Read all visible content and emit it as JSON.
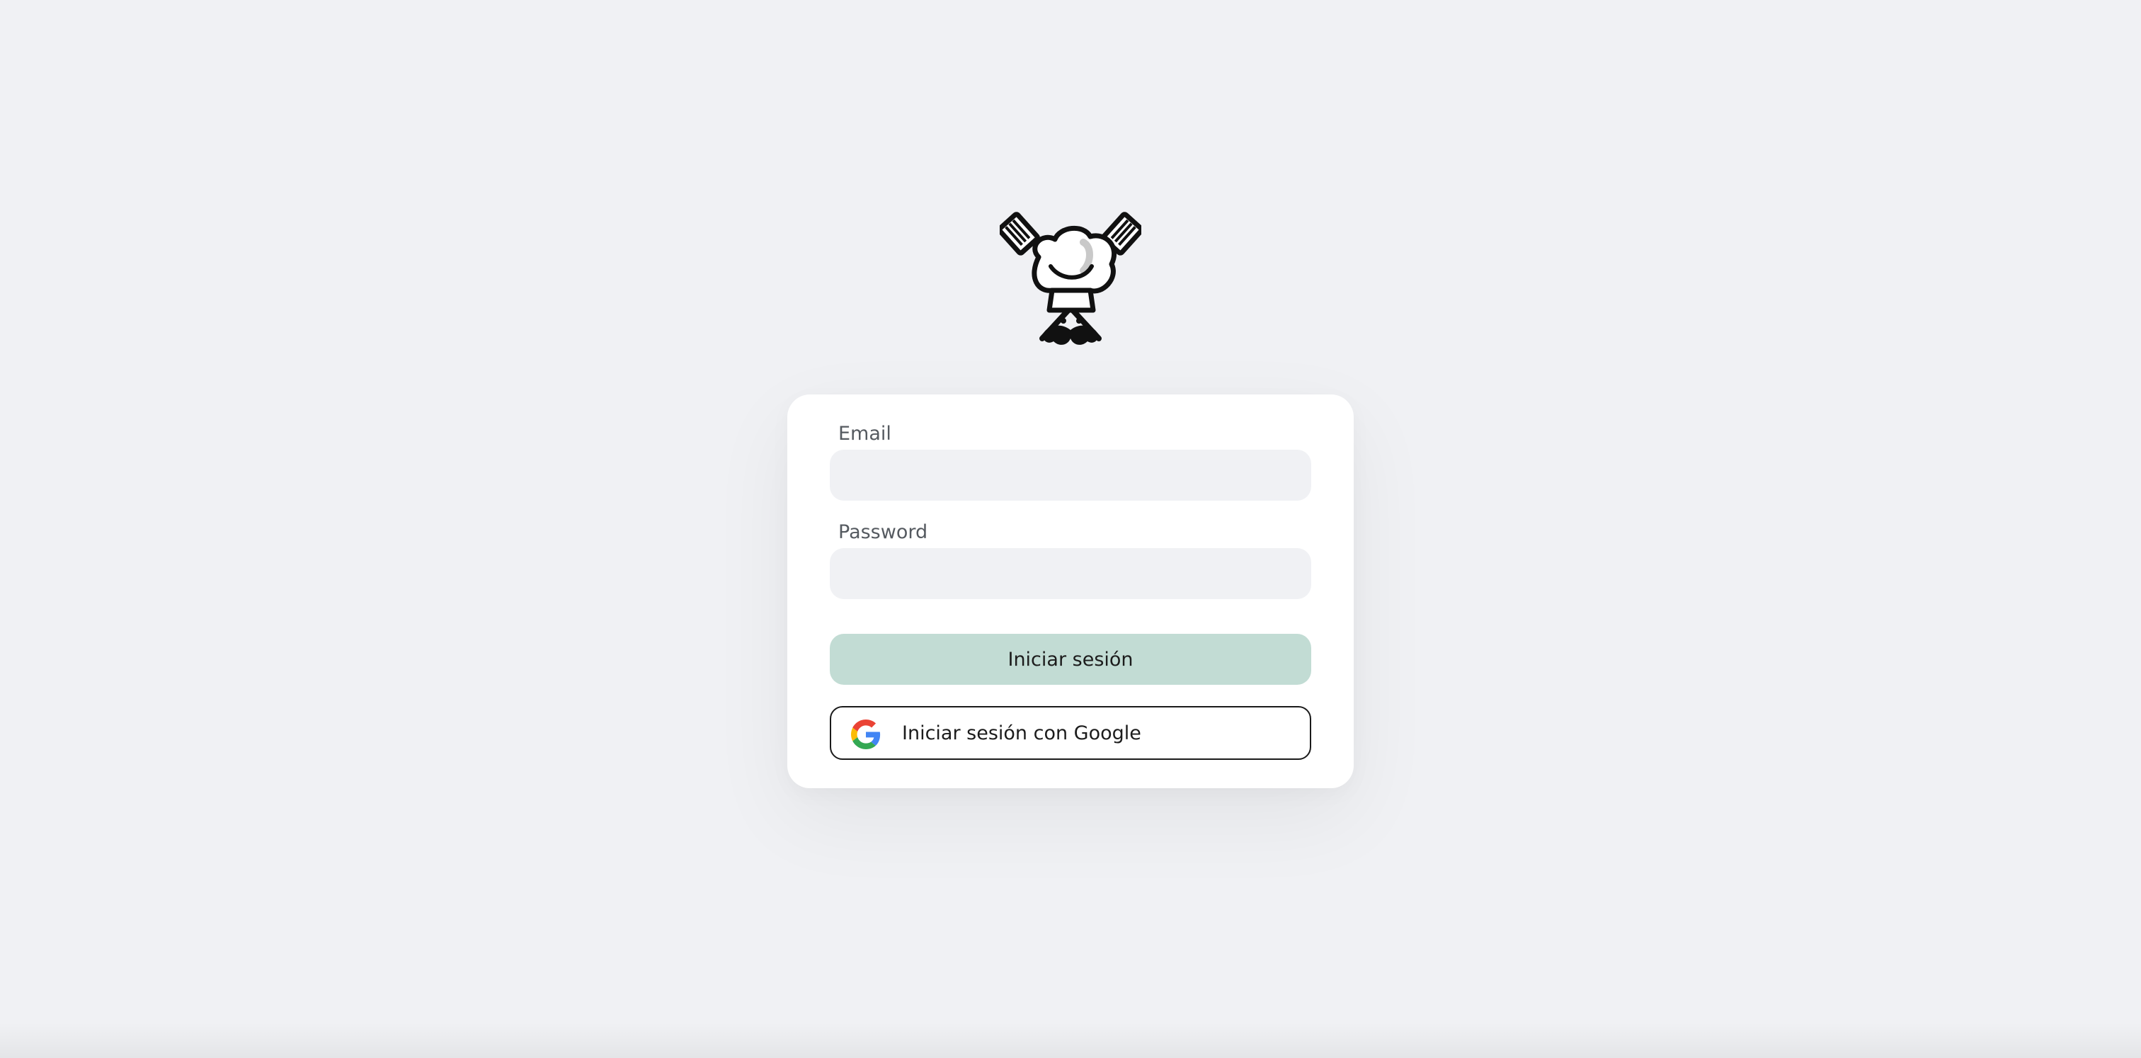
{
  "logo": {
    "icon": "chef-mascot-icon"
  },
  "login_form": {
    "email_label": "Email",
    "email_value": "",
    "email_placeholder": "",
    "password_label": "Password",
    "password_value": "",
    "password_placeholder": "",
    "submit_label": "Iniciar sesión",
    "google_label": "Iniciar sesión con Google",
    "google_icon": "google-icon"
  },
  "colors": {
    "background": "#f0f1f4",
    "card": "#ffffff",
    "primary_button": "#c2dcd4",
    "input_fill": "#f0f1f4"
  }
}
